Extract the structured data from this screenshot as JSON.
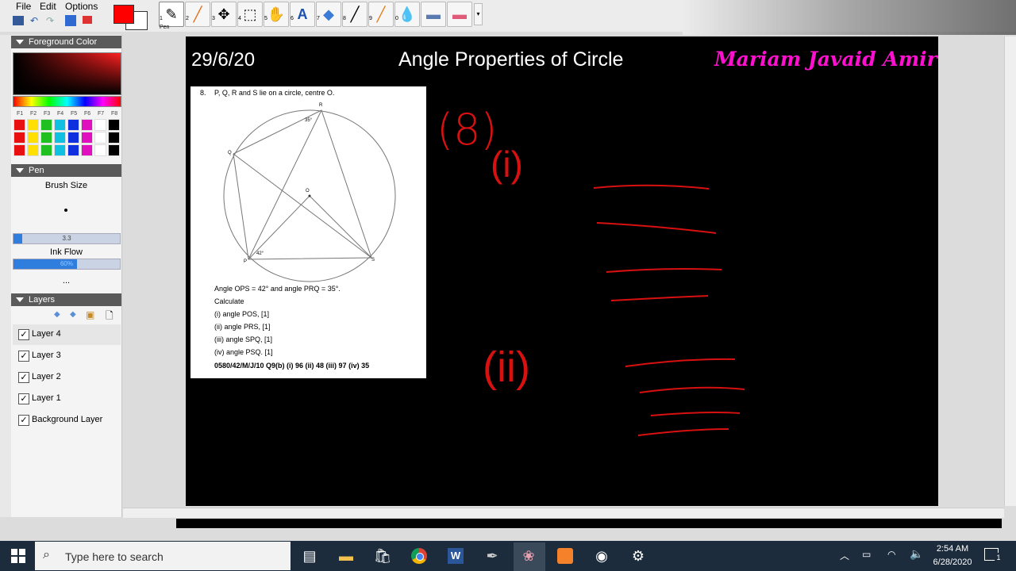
{
  "menu": {
    "file": "File",
    "edit": "Edit",
    "options": "Options"
  },
  "toolbar": {
    "pen_label": "Pen",
    "tool_numbers": [
      "1",
      "2",
      "3",
      "4",
      "5",
      "6",
      "7",
      "8",
      "9",
      "0"
    ]
  },
  "colors": {
    "foreground": "#ff0000",
    "background": "#ffffff",
    "ink": "#d81010"
  },
  "left_panel": {
    "foreground_color_header": "Foreground Color",
    "fkeys": [
      "F1",
      "F2",
      "F3",
      "F4",
      "F5",
      "F6",
      "F7",
      "F8"
    ],
    "pen_header": "Pen",
    "brush_size_label": "Brush Size",
    "brush_size_value": "3.3",
    "brush_size_fraction": 0.08,
    "ink_flow_label": "Ink Flow",
    "ink_flow_value": "60%",
    "ink_flow_fraction": 0.6,
    "more": "...",
    "layers_header": "Layers",
    "layers": [
      {
        "name": "Layer 4",
        "checked": true,
        "selected": true
      },
      {
        "name": "Layer 3",
        "checked": true
      },
      {
        "name": "Layer 2",
        "checked": true
      },
      {
        "name": "Layer 1",
        "checked": true
      },
      {
        "name": "Background Layer",
        "checked": true
      }
    ]
  },
  "canvas": {
    "date": "29/6/20",
    "title": "Angle Properties of Circle",
    "author": "Mariam Javaid Amir",
    "handwriting": {
      "q8": "(8)",
      "part1": "(i)",
      "part2": "(ii)"
    }
  },
  "question": {
    "number": "8.",
    "intro": "P, Q, R and S lie on a circle, centre O.",
    "points": {
      "p": "P",
      "q": "Q",
      "r": "R",
      "s": "S",
      "o": "O"
    },
    "angle_p": "42°",
    "angle_r": "35°",
    "given": "Angle OPS = 42° and angle PRQ = 35°.",
    "calculate": "Calculate",
    "parts": [
      "(i) angle POS, [1]",
      "(ii) angle PRS, [1]",
      "(iii) angle SPQ, [1]",
      "(iv) angle PSQ. [1]"
    ],
    "reference": "0580/42/M/J/10 Q9(b) (i) 96 (ii) 48 (iii) 97 (iv) 35"
  },
  "taskbar": {
    "search_placeholder": "Type here to search",
    "time": "2:54 AM",
    "date": "6/28/2020",
    "notification_count": "1"
  }
}
